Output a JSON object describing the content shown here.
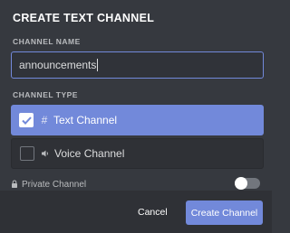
{
  "modal": {
    "title": "CREATE TEXT CHANNEL"
  },
  "channel_name": {
    "label": "CHANNEL NAME",
    "value": "announcements"
  },
  "channel_type": {
    "label": "CHANNEL TYPE",
    "options": [
      {
        "label": "Text Channel",
        "icon": "hash-icon",
        "checked": true
      },
      {
        "label": "Voice Channel",
        "icon": "speaker-icon",
        "checked": false
      }
    ]
  },
  "private": {
    "label": "Private Channel",
    "enabled": false
  },
  "footer": {
    "cancel_label": "Cancel",
    "create_label": "Create Channel"
  },
  "colors": {
    "accent": "#7289da",
    "background": "#36393f",
    "footer": "#2f3136"
  }
}
